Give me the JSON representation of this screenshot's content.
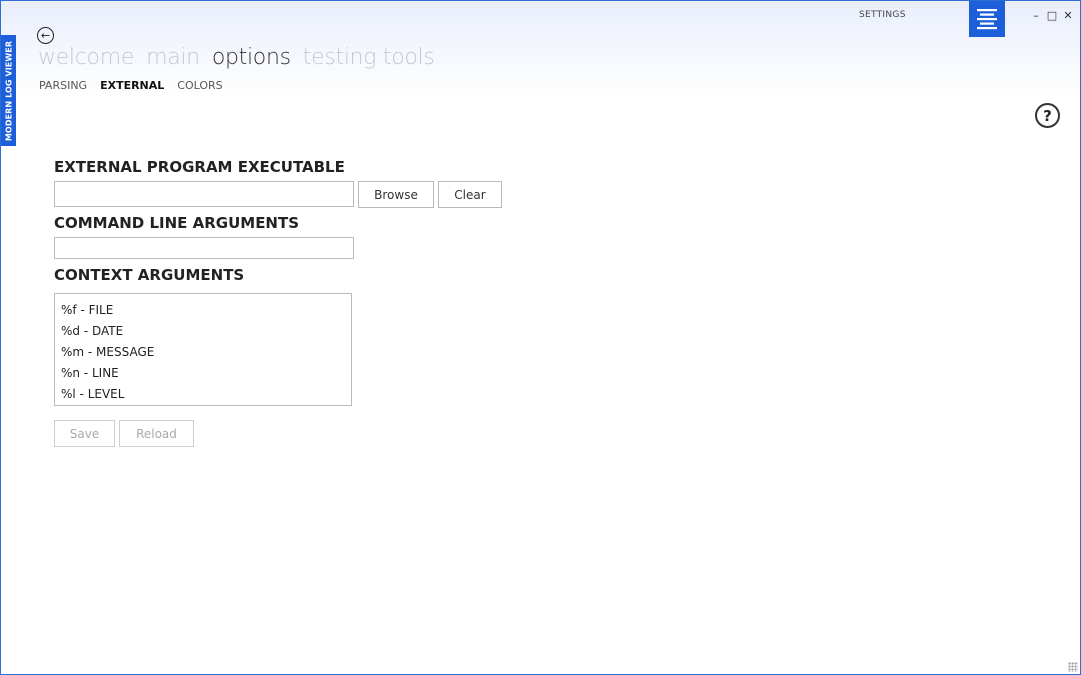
{
  "app": {
    "side_title": "MODERN LOG VIEWER",
    "page_label": "SETTINGS"
  },
  "hub": {
    "sections": [
      {
        "label": "welcome",
        "active": false
      },
      {
        "label": "main",
        "active": false
      },
      {
        "label": "options",
        "active": true
      },
      {
        "label": "testing tools",
        "active": false
      }
    ]
  },
  "subnav": {
    "tabs": [
      {
        "label": "PARSING",
        "active": false
      },
      {
        "label": "EXTERNAL",
        "active": true
      },
      {
        "label": "COLORS",
        "active": false
      }
    ]
  },
  "icons": {
    "back": "arrow-left-icon",
    "menu": "menu-icon",
    "minimize": "minimize-icon",
    "maximize": "maximize-icon",
    "close": "close-icon",
    "help": "question-icon"
  },
  "colors": {
    "accent": "#1d5fd8",
    "border": "#2b6fd6"
  },
  "external": {
    "executable_title": "EXTERNAL PROGRAM EXECUTABLE",
    "executable_value": "",
    "browse_label": "Browse",
    "clear_label": "Clear",
    "cmdline_title": "COMMAND LINE ARGUMENTS",
    "cmdline_value": "",
    "context_title": "CONTEXT ARGUMENTS",
    "context_items": [
      "%f - FILE",
      "%d - DATE",
      "%m - MESSAGE",
      "%n - LINE",
      "%l - LEVEL"
    ],
    "save_label": "Save",
    "reload_label": "Reload"
  }
}
